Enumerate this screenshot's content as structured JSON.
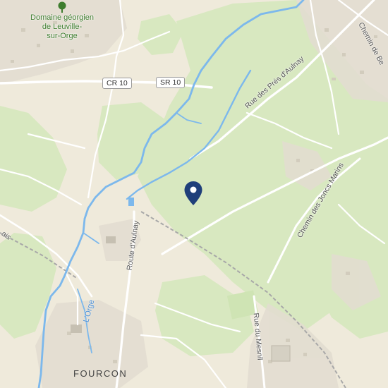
{
  "map": {
    "poi": {
      "name_line1": "Domaine géorgien",
      "name_line2": "de Leuville-",
      "name_line3": "sur-Orge",
      "icon": "tree-icon",
      "color": "#3e7d2e"
    },
    "shields": {
      "cr10": "CR 10",
      "sr10": "SR 10"
    },
    "roads": {
      "chemin_de_be": "Chemin de Be",
      "rue_pres_aulnay": "Rue des Prés d'Aulnay",
      "chemin_joncs_marins": "Chemin des Joncs Marins",
      "route_aulnay": "Route d'Aulnay",
      "rue_du_mesnil": "Rue du Mesnil",
      "edge_fragment": "ais"
    },
    "water": {
      "river": "L'Orge",
      "color": "#7cb8ec"
    },
    "places": {
      "fourcon": "FOURCON"
    },
    "marker": {
      "icon": "location-pin-icon",
      "color": "#1f3f7a"
    },
    "colors": {
      "land": "#efeadb",
      "forest": "#d8e8c0",
      "built": "#e2ddd0",
      "road": "#ffffff",
      "rail": "#9a9a9a"
    }
  }
}
